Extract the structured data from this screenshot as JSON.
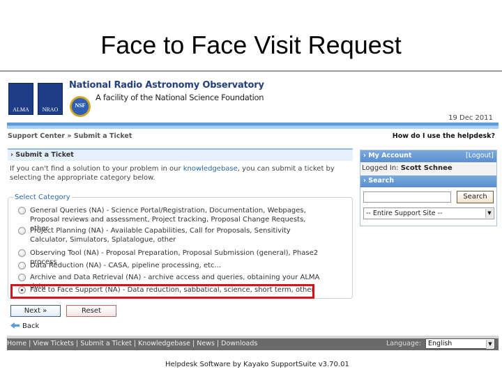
{
  "slide": {
    "title": "Face to Face Visit Request"
  },
  "header": {
    "logos": {
      "alma": "ALMA",
      "nrao": "NRAO",
      "nsf": "NSF"
    },
    "org_name": "National Radio Astronomy Observatory",
    "org_sub": "A facility of the National Science Foundation",
    "date": "19 Dec 2011"
  },
  "nav": {
    "breadcrumb": "Support Center » Submit a Ticket",
    "help_link": "How do I use the helpdesk?"
  },
  "main": {
    "panel_title": "› Submit a Ticket",
    "intro_before": "If you can't find a solution to your problem in our ",
    "intro_link": "knowledgebase",
    "intro_after": ", you can submit a ticket by selecting the appropriate category below.",
    "category_legend": "Select Category",
    "categories": [
      {
        "label": "General Queries (NA) - Science Portal/Registration, Documentation, Webpages, Proposal reviews and assessment, Project tracking, Proposal Change Requests, other",
        "selected": false
      },
      {
        "label": "Project Planning (NA) - Available Capabilities, Call for Proposals, Sensitivity Calculator, Simulators, Splatalogue, other",
        "selected": false
      },
      {
        "label": "Observing Tool (NA) - Proposal Preparation, Proposal Submission (general), Phase2 process",
        "selected": false
      },
      {
        "label": "Data Reduction (NA) - CASA, pipeline processing, etc...",
        "selected": false
      },
      {
        "label": "Archive and Data Retrieval (NA) - archive access and queries, obtaining your ALMA data",
        "selected": false
      },
      {
        "label": "Face to Face Support (NA) - Data reduction, sabbatical, science, short term, other",
        "selected": true
      }
    ],
    "next_label": "Next »",
    "reset_label": "Reset",
    "back_label": "Back",
    "highlight_color": "#d6121e"
  },
  "sidebar": {
    "account_title": "› My Account",
    "logout": "[Logout]",
    "logged_in_label": "Logged In:",
    "user": "Scott Schnee",
    "search_title": "› Search",
    "search_value": "",
    "search_button": "Search",
    "scope": "-- Entire Support Site --"
  },
  "footer": {
    "links": [
      "Home",
      "View Tickets",
      "Submit a Ticket",
      "Knowledgebase",
      "News",
      "Downloads"
    ],
    "language_label": "Language:",
    "language": "English",
    "powered_by": "Helpdesk Software by Kayako SupportSuite v3.70.01"
  }
}
